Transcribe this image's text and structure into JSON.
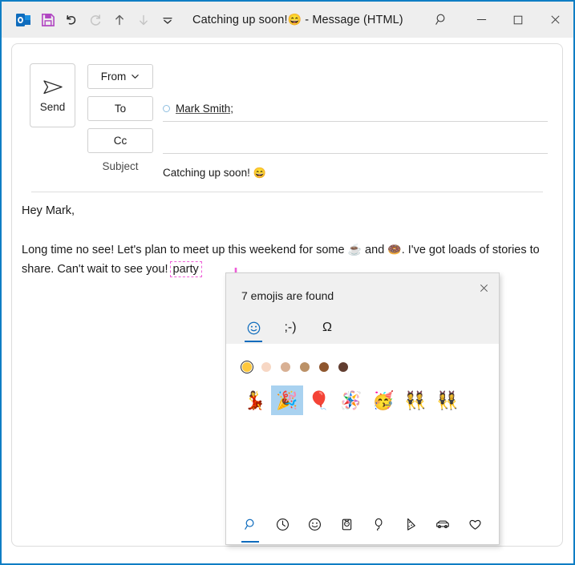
{
  "window": {
    "title": "Catching up soon!",
    "title_emoji": "😄",
    "title_suffix": "-  Message (HTML)",
    "accent_color": "#0f7ec4"
  },
  "titlebar": {
    "icons": [
      {
        "name": "outlook-logo",
        "glyph": "O"
      },
      {
        "name": "save-icon",
        "glyph": "save"
      },
      {
        "name": "undo-icon",
        "glyph": "undo"
      },
      {
        "name": "redo-icon",
        "glyph": "redo"
      },
      {
        "name": "move-up-icon",
        "glyph": "up"
      },
      {
        "name": "move-down-icon",
        "glyph": "down"
      },
      {
        "name": "customize-toolbar-icon",
        "glyph": "chevron"
      }
    ],
    "controls": [
      {
        "name": "search-icon",
        "glyph": "search"
      },
      {
        "name": "minimize-icon",
        "glyph": "minimize"
      },
      {
        "name": "maximize-icon",
        "glyph": "maximize"
      },
      {
        "name": "close-icon",
        "glyph": "close"
      }
    ]
  },
  "compose": {
    "send_label": "Send",
    "from_label": "From",
    "to_label": "To",
    "cc_label": "Cc",
    "subject_label": "Subject",
    "to_value": "Mark Smith;",
    "cc_value": "",
    "subject_value": "Catching up soon!",
    "subject_emoji": "😄"
  },
  "body": {
    "greeting": "Hey Mark,",
    "para_part1": "Long time no see! Let's plan to meet up this weekend for some ",
    "emoji_coffee": "☕",
    "para_part2": " and ",
    "emoji_donut": "🍩",
    "para_part3": ". I've got loads of stories to share. Can't wait to see you!",
    "typed_word": "party"
  },
  "annotation": {
    "color": "#ef5fd8",
    "target_word": "party"
  },
  "emoji_panel": {
    "result_count_text": "7 emojis are found",
    "close_label": "×",
    "tabs": [
      {
        "name": "tab-emoji",
        "label": "☺",
        "active": true
      },
      {
        "name": "tab-kaomoji",
        "label": ";-)",
        "active": false
      },
      {
        "name": "tab-symbols",
        "label": "Ω",
        "active": false
      }
    ],
    "skin_tones": [
      {
        "name": "skin-tone-default",
        "color": "#ffc83d",
        "selected": true
      },
      {
        "name": "skin-tone-light",
        "color": "#f7d7c4",
        "selected": false
      },
      {
        "name": "skin-tone-medium-light",
        "color": "#d8b094",
        "selected": false
      },
      {
        "name": "skin-tone-medium",
        "color": "#bb9167",
        "selected": false
      },
      {
        "name": "skin-tone-medium-dark",
        "color": "#8e562e",
        "selected": false
      },
      {
        "name": "skin-tone-dark",
        "color": "#613d30",
        "selected": false
      }
    ],
    "results": [
      {
        "name": "emoji-woman-dancing",
        "glyph": "💃",
        "selected": false
      },
      {
        "name": "emoji-party-popper",
        "glyph": "🎉",
        "selected": true
      },
      {
        "name": "emoji-balloon",
        "glyph": "🎈",
        "selected": false
      },
      {
        "name": "emoji-pinata",
        "glyph": "🪅",
        "selected": false
      },
      {
        "name": "emoji-partying-face",
        "glyph": "🥳",
        "selected": false
      },
      {
        "name": "emoji-people-bunny-ears",
        "glyph": "👯",
        "selected": false
      },
      {
        "name": "emoji-women-bunny-ears",
        "glyph": "👯‍♀️",
        "selected": false
      }
    ],
    "bottom_nav": [
      {
        "name": "nav-search",
        "glyph": "search",
        "active": true
      },
      {
        "name": "nav-recent",
        "glyph": "clock",
        "active": false
      },
      {
        "name": "nav-smileys",
        "glyph": "smiley",
        "active": false
      },
      {
        "name": "nav-people",
        "glyph": "person",
        "active": false
      },
      {
        "name": "nav-celebration",
        "glyph": "balloon",
        "active": false
      },
      {
        "name": "nav-food",
        "glyph": "pizza",
        "active": false
      },
      {
        "name": "nav-travel",
        "glyph": "car",
        "active": false
      },
      {
        "name": "nav-symbols",
        "glyph": "heart",
        "active": false
      }
    ]
  }
}
